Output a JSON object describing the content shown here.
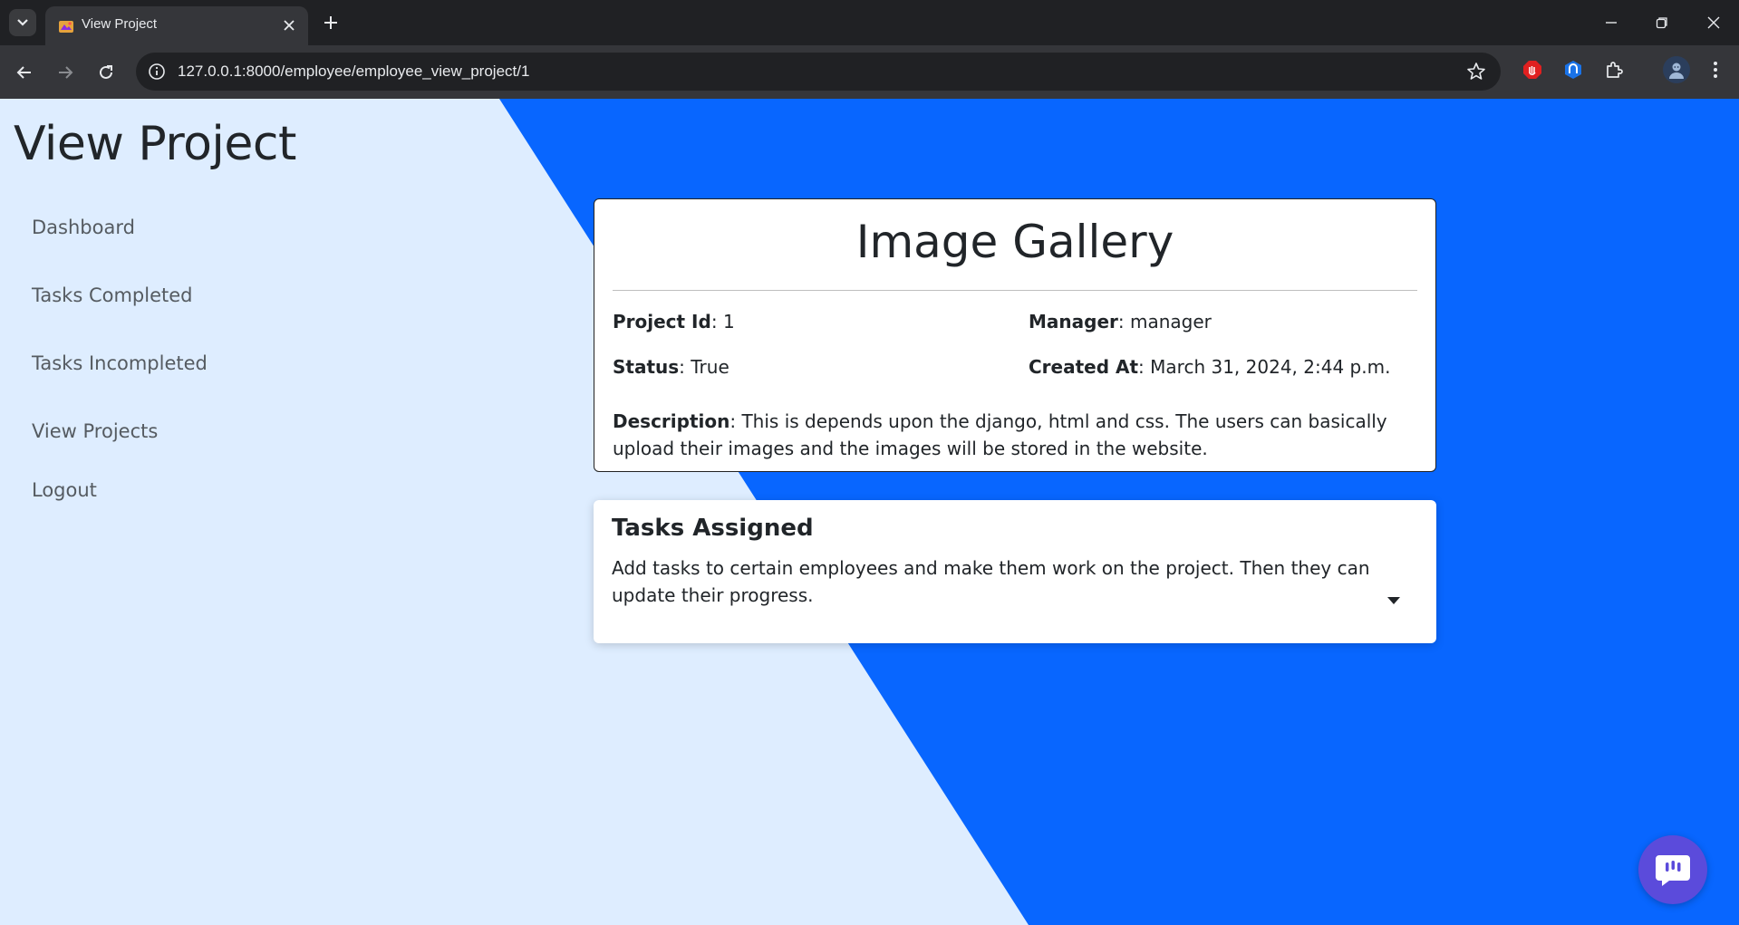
{
  "browser": {
    "tab_title": "View Project",
    "url": "127.0.0.1:8000/employee/employee_view_project/1"
  },
  "page": {
    "title": "View Project"
  },
  "sidebar": {
    "items": [
      {
        "label": "Dashboard"
      },
      {
        "label": "Tasks Completed"
      },
      {
        "label": "Tasks Incompleted"
      },
      {
        "label": "View Projects"
      },
      {
        "label": "Logout"
      }
    ]
  },
  "project": {
    "name": "Image Gallery",
    "id_label": "Project Id",
    "id_value": "1",
    "manager_label": "Manager",
    "manager_value": "manager",
    "status_label": "Status",
    "status_value": "True",
    "created_label": "Created At",
    "created_value": "March 31, 2024, 2:44 p.m.",
    "description_label": "Description",
    "description_value": "This is depends upon the django, html and css. The users can basically upload their images and the images will be stored in the website."
  },
  "tasks": {
    "title": "Tasks Assigned",
    "description": "Add tasks to certain employees and make them work on the project. Then they can update their progress."
  },
  "colors": {
    "page_bg_blue": "#0866ff",
    "page_bg_light": "#deedff",
    "chat_button": "#5b4bdb"
  },
  "icons": [
    "tab-search-icon",
    "favicon-icon",
    "close-icon",
    "plus-icon",
    "minimize-icon",
    "restore-icon",
    "back-icon",
    "forward-icon",
    "reload-icon",
    "site-info-icon",
    "star-icon",
    "adblock-icon",
    "extension-icon",
    "puzzle-icon",
    "profile-avatar-icon",
    "kebab-menu-icon",
    "chevron-down-icon",
    "chat-icon"
  ]
}
